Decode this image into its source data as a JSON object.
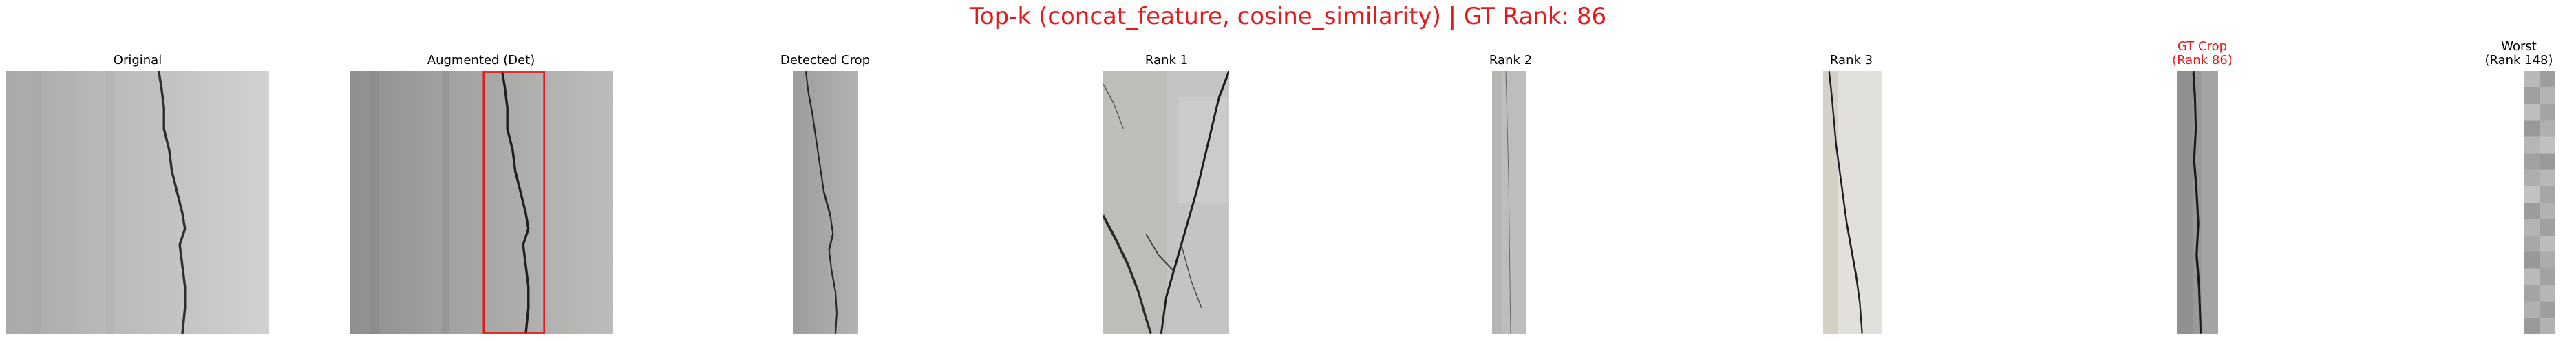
{
  "figure": {
    "title": "Top-k (concat_feature, cosine_similarity) | GT Rank: 86",
    "title_color": "#e31a1c",
    "bbox_color": "#e31a1c"
  },
  "panels": [
    {
      "id": "original",
      "title": "Original",
      "title_color": "#000000",
      "image": "concrete wall with vertical hairline crack"
    },
    {
      "id": "augmented",
      "title": "Augmented (Det)",
      "title_color": "#000000",
      "image": "augmented concrete wall with detection box around the crack"
    },
    {
      "id": "detected-crop",
      "title": "Detected Crop",
      "title_color": "#000000",
      "image": "narrow crop of the detected crack"
    },
    {
      "id": "rank-1",
      "title": "Rank 1",
      "title_color": "#000000",
      "image": "close-up of branching crack on light stucco"
    },
    {
      "id": "rank-2",
      "title": "Rank 2",
      "title_color": "#000000",
      "image": "thin strip with faint crack"
    },
    {
      "id": "rank-3",
      "title": "Rank 3",
      "title_color": "#000000",
      "image": "light wall with dark diagonal crack"
    },
    {
      "id": "gt-crop",
      "title_line1": "GT Crop",
      "title_line2": "(Rank 86)",
      "title_color": "#e31a1c",
      "image": "ground-truth crack crop"
    },
    {
      "id": "worst",
      "title_line1": "Worst",
      "title_line2": "(Rank 148)",
      "title_color": "#000000",
      "image": "blurry pixelated grey strip"
    }
  ]
}
